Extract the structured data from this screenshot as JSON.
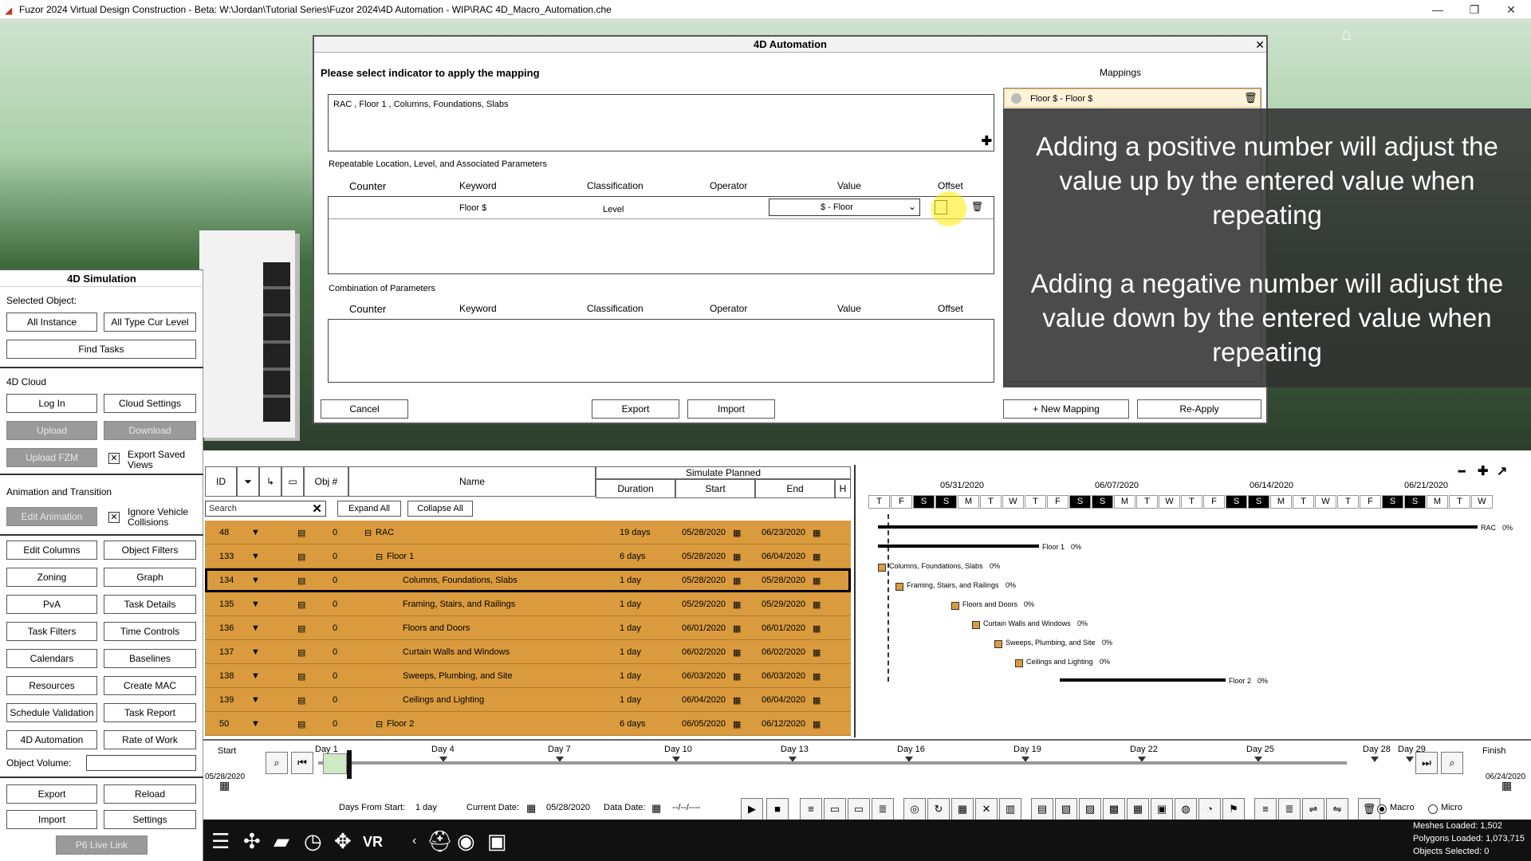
{
  "window": {
    "title": "Fuzor 2024 Virtual Design Construction - Beta: W:\\Jordan\\Tutorial Series\\Fuzor 2024\\4D Automation - WIP\\RAC 4D_Macro_Automation.che",
    "minimize": "—",
    "maximize": "❐",
    "close": "✕"
  },
  "scene": {
    "date_ghost": ""
  },
  "left_panel": {
    "title": "4D Simulation",
    "selected_object_label": "Selected Object:",
    "all_instance": "All Instance",
    "all_type_cur_level": "All Type Cur Level",
    "find_tasks": "Find Tasks",
    "cloud_label": "4D Cloud",
    "log_in": "Log In",
    "cloud_settings": "Cloud Settings",
    "upload": "Upload",
    "download": "Download",
    "upload_fzm": "Upload FZM",
    "export_saved_views": "Export Saved Views",
    "anim_label": "Animation and Transition",
    "edit_animation": "Edit Animation",
    "ignore_vehicle": "Ignore Vehicle Collisions",
    "buttons": [
      "Edit Columns",
      "Object Filters",
      "Zoning",
      "Graph",
      "PvA",
      "Task Details",
      "Task Filters",
      "Time Controls",
      "Calendars",
      "Baselines",
      "Resources",
      "Create MAC",
      "Schedule Validation",
      "Task Report",
      "4D Automation",
      "Rate of Work"
    ],
    "object_volume": "Object Volume:",
    "export": "Export",
    "reload": "Reload",
    "import": "Import",
    "settings": "Settings",
    "p6": "P6 Live Link"
  },
  "dialog": {
    "title": "4D Automation",
    "prompt": "Please select indicator to apply the mapping",
    "mappings_label": "Mappings",
    "indicator_text": "RAC , Floor 1 , Columns, Foundations, Slabs",
    "mapping_item": "Floor $ - Floor $",
    "repeatable_label": "Repeatable Location, Level, and Associated Parameters",
    "combination_label": "Combination of Parameters",
    "cols": [
      "Counter",
      "Keyword",
      "Classification",
      "Operator",
      "Value",
      "Offset"
    ],
    "param_row": {
      "keyword": "Floor $",
      "classification": "Level",
      "value": "$ - Floor"
    },
    "cancel": "Cancel",
    "export": "Export",
    "import": "Import",
    "new_mapping": "+ New Mapping",
    "reapply": "Re-Apply",
    "overlay_p1": "Adding a positive number will adjust the value up by the entered value when repeating",
    "overlay_p2": "Adding a negative number will adjust the value down by the entered value when repeating"
  },
  "grid": {
    "headers": {
      "id": "ID",
      "obj": "Obj #",
      "name": "Name",
      "sim": "Simulate Planned",
      "duration": "Duration",
      "start": "Start",
      "end": "End",
      "h": "H"
    },
    "search_placeholder": "Search",
    "expand_all": "Expand All",
    "collapse_all": "Collapse All",
    "rows": [
      {
        "id": "48",
        "obj": "0",
        "name": "RAC",
        "dur": "19 days",
        "start": "05/28/2020",
        "end": "06/23/2020"
      },
      {
        "id": "133",
        "obj": "0",
        "name": "Floor 1",
        "dur": "6 days",
        "start": "05/28/2020",
        "end": "06/04/2020"
      },
      {
        "id": "134",
        "obj": "0",
        "name": "Columns, Foundations, Slabs",
        "dur": "1 day",
        "start": "05/28/2020",
        "end": "05/28/2020"
      },
      {
        "id": "135",
        "obj": "0",
        "name": "Framing, Stairs, and Railings",
        "dur": "1 day",
        "start": "05/29/2020",
        "end": "05/29/2020"
      },
      {
        "id": "136",
        "obj": "0",
        "name": "Floors and Doors",
        "dur": "1 day",
        "start": "06/01/2020",
        "end": "06/01/2020"
      },
      {
        "id": "137",
        "obj": "0",
        "name": "Curtain Walls and Windows",
        "dur": "1 day",
        "start": "06/02/2020",
        "end": "06/02/2020"
      },
      {
        "id": "138",
        "obj": "0",
        "name": "Sweeps, Plumbing, and Site",
        "dur": "1 day",
        "start": "06/03/2020",
        "end": "06/03/2020"
      },
      {
        "id": "139",
        "obj": "0",
        "name": "Ceilings and Lighting",
        "dur": "1 day",
        "start": "06/04/2020",
        "end": "06/04/2020"
      },
      {
        "id": "50",
        "obj": "0",
        "name": "Floor 2",
        "dur": "6 days",
        "start": "06/05/2020",
        "end": "06/12/2020"
      }
    ]
  },
  "gantt": {
    "weeks": [
      "05/31/2020",
      "06/07/2020",
      "06/14/2020",
      "06/21/2020"
    ],
    "days": [
      "T",
      "F",
      "S",
      "S",
      "M",
      "T",
      "W",
      "T",
      "F",
      "S",
      "S",
      "M",
      "T",
      "W",
      "T",
      "F",
      "S",
      "S",
      "M",
      "T",
      "W",
      "T",
      "F",
      "S",
      "S",
      "M",
      "T",
      "W"
    ],
    "weekend_indexes": [
      2,
      3,
      9,
      10,
      16,
      17,
      23,
      24
    ],
    "bars": [
      {
        "label": "RAC",
        "pct": "0%"
      },
      {
        "label": "Floor 1",
        "pct": "0%"
      },
      {
        "label": "Columns, Foundations, Slabs",
        "pct": "0%"
      },
      {
        "label": "Framing, Stairs, and Railings",
        "pct": "0%"
      },
      {
        "label": "Floors and Doors",
        "pct": "0%"
      },
      {
        "label": "Curtain Walls and Windows",
        "pct": "0%"
      },
      {
        "label": "Sweeps, Plumbing, and Site",
        "pct": "0%"
      },
      {
        "label": "Ceilings and Lighting",
        "pct": "0%"
      },
      {
        "label": "Floor 2",
        "pct": "0%"
      }
    ]
  },
  "timeline": {
    "start_label": "Start",
    "finish_label": "Finish",
    "start_date": "05/28/2020",
    "finish_date": "06/24/2020",
    "day_marks": [
      "Day 1",
      "Day 4",
      "Day 7",
      "Day 10",
      "Day 13",
      "Day 16",
      "Day 19",
      "Day 22",
      "Day 25",
      "Day 28",
      "Day 29"
    ],
    "days_from_start_label": "Days From Start:",
    "days_from_start": "1 day",
    "current_date_label": "Current Date:",
    "current_date": "05/28/2020",
    "data_date_label": "Data Date:",
    "data_date": "--/--/----",
    "macro": "Macro",
    "micro": "Micro"
  },
  "stats": {
    "meshes": "Meshes Loaded: 1,502",
    "polygons": "Polygons Loaded: 1,073,715",
    "objects": "Objects Selected: 0"
  }
}
